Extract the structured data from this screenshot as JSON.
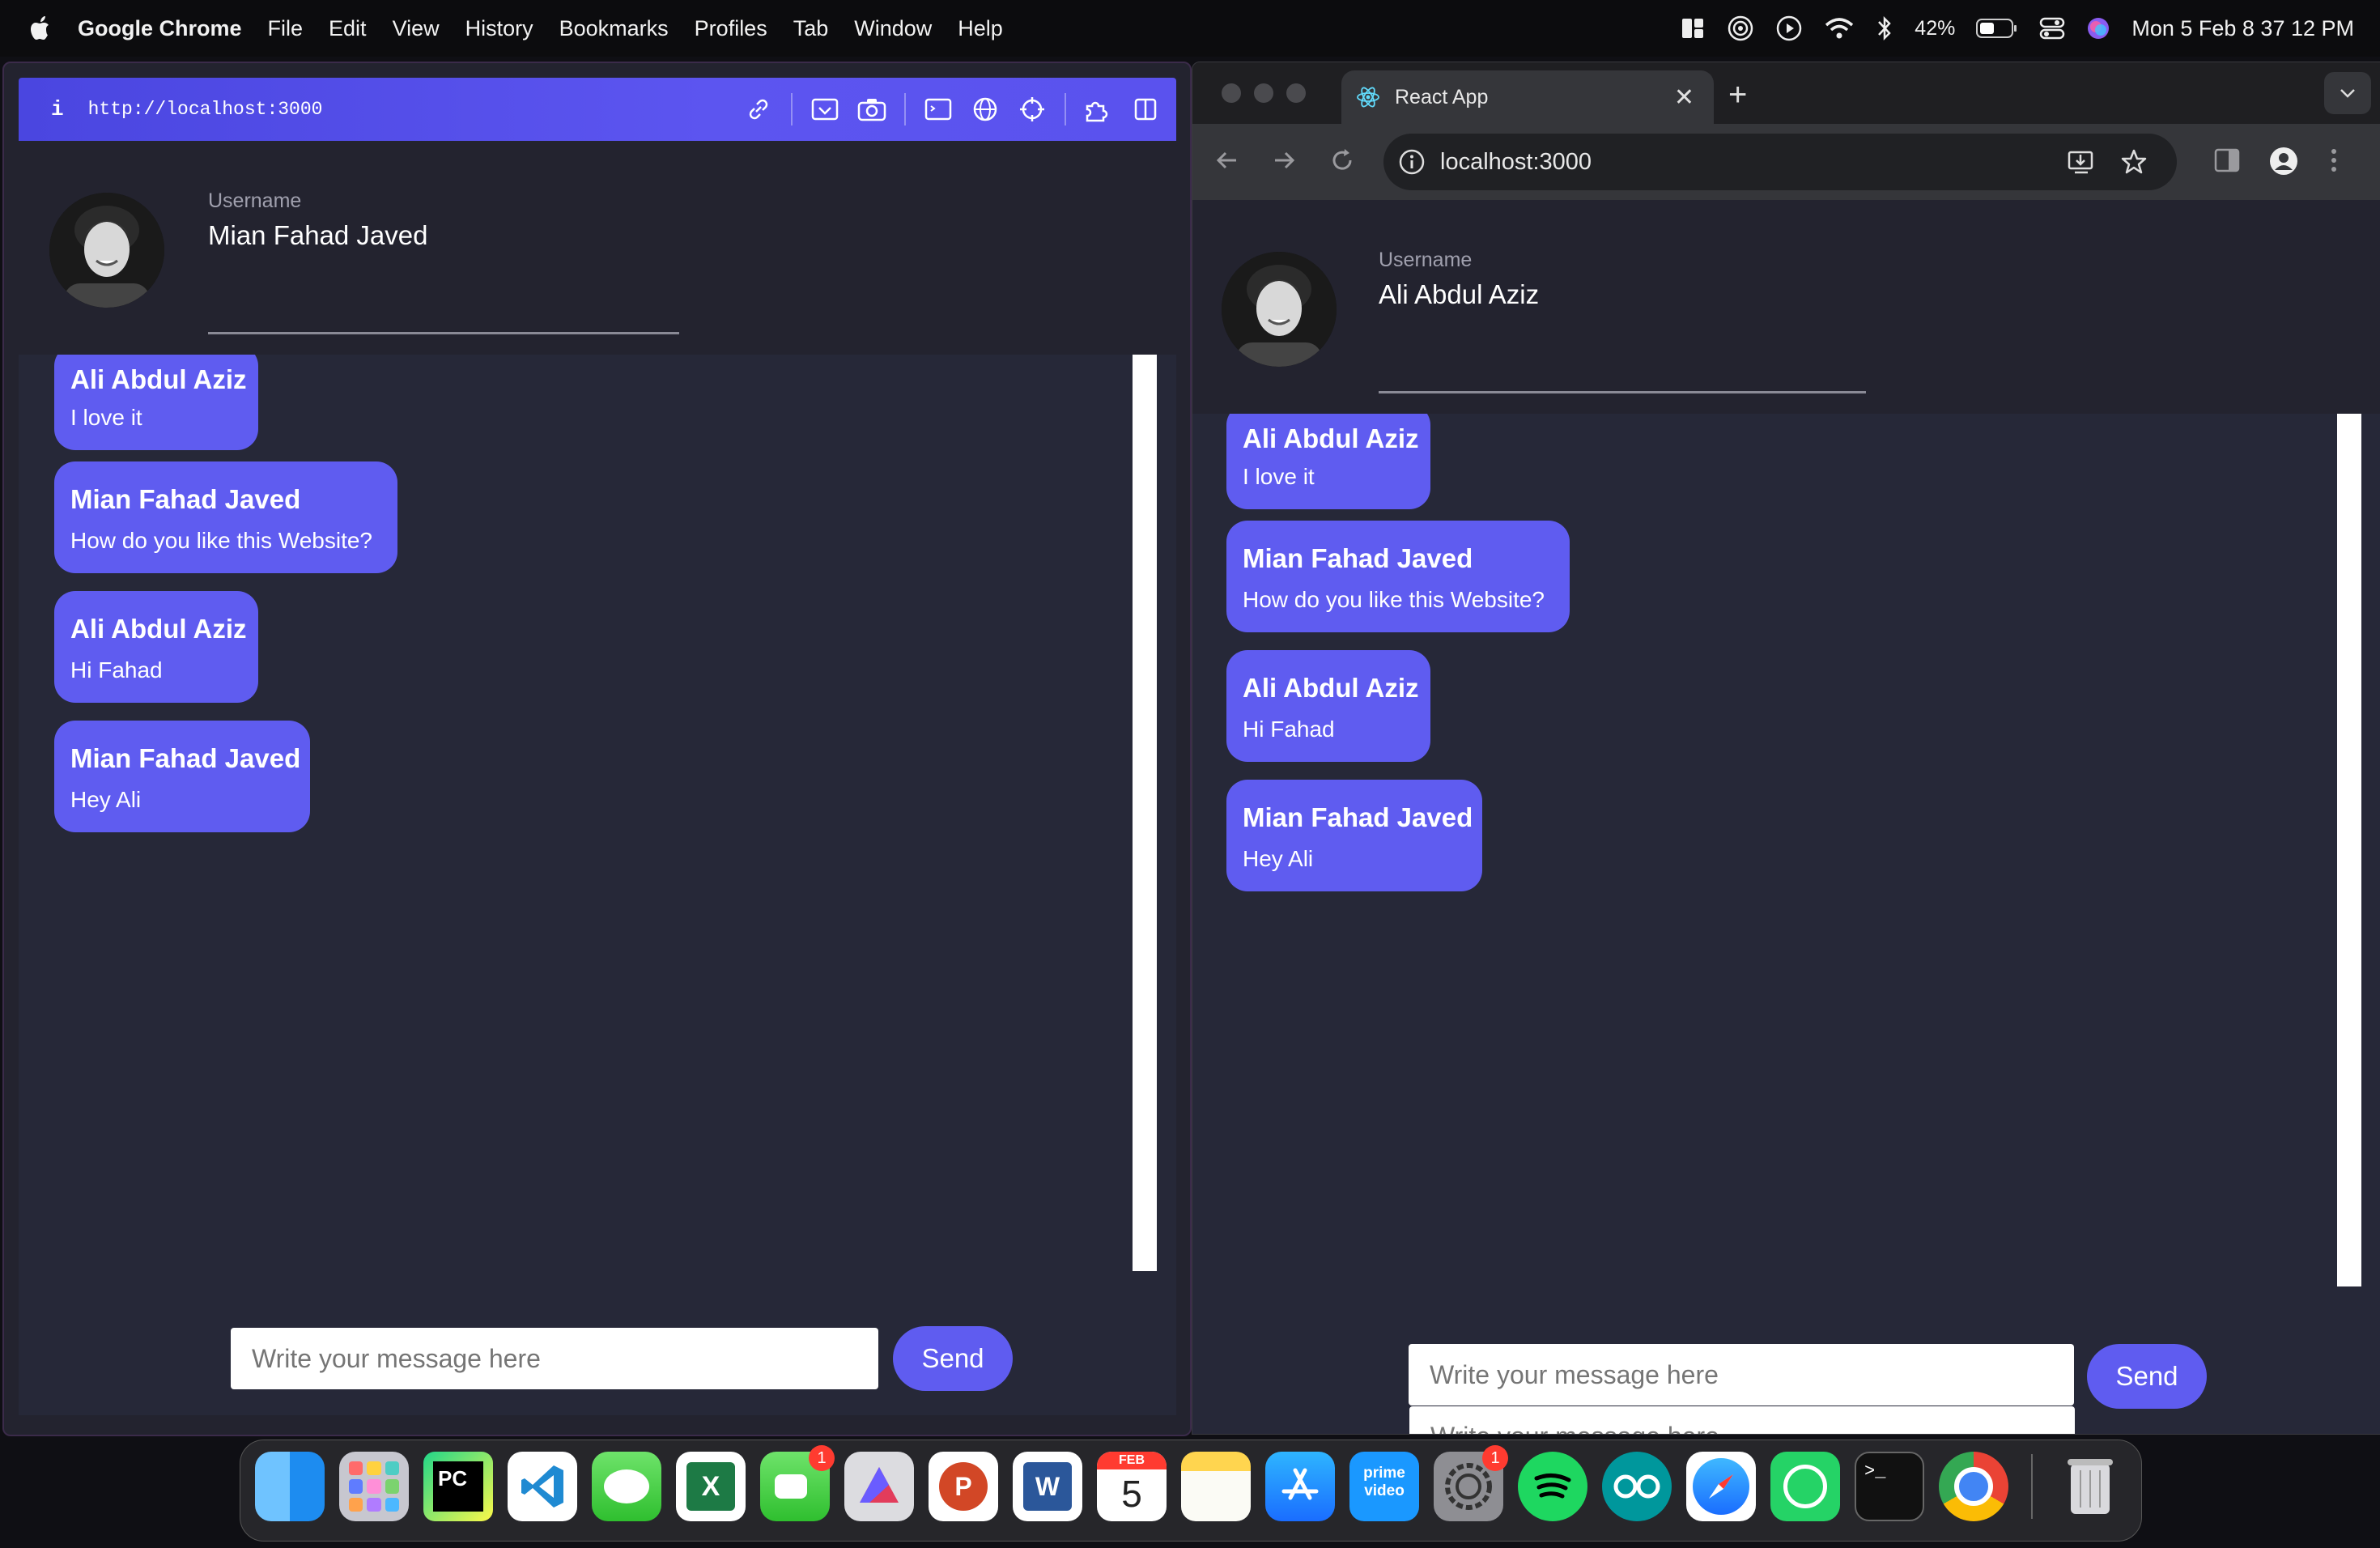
{
  "menubar": {
    "app_name": "Google Chrome",
    "items": [
      "File",
      "Edit",
      "View",
      "History",
      "Bookmarks",
      "Profiles",
      "Tab",
      "Window",
      "Help"
    ],
    "battery": "42%",
    "clock": "Mon 5 Feb  8 37 12 PM"
  },
  "left_window": {
    "info_label": "i",
    "url": "http://localhost:3000",
    "username_label": "Username",
    "username_value": "Mian Fahad Javed",
    "messages": [
      {
        "sender": "Ali Abdul Aziz",
        "text": "I love it"
      },
      {
        "sender": "Mian Fahad Javed",
        "text": "How do you like this Website?"
      },
      {
        "sender": "Ali Abdul Aziz",
        "text": "Hi Fahad"
      },
      {
        "sender": "Mian Fahad Javed",
        "text": "Hey Ali"
      }
    ],
    "input_placeholder": "Write your message here",
    "send_label": "Send"
  },
  "right_window": {
    "tab_title": "React App",
    "url": "localhost:3000",
    "username_label": "Username",
    "username_value": "Ali Abdul Aziz",
    "messages": [
      {
        "sender": "Ali Abdul Aziz",
        "text": "I love it"
      },
      {
        "sender": "Mian Fahad Javed",
        "text": "How do you like this Website?"
      },
      {
        "sender": "Ali Abdul Aziz",
        "text": "Hi Fahad"
      },
      {
        "sender": "Mian Fahad Javed",
        "text": "Hey Ali"
      }
    ],
    "input_placeholder": "Write your message here",
    "send_label": "Send"
  },
  "dock": {
    "apps": [
      "finder",
      "launchpad",
      "pycharm",
      "vscode",
      "messages",
      "excel",
      "facetime",
      "affinity",
      "powerpoint",
      "word",
      "calendar",
      "notes",
      "app-store",
      "prime-video",
      "system-settings",
      "spotify",
      "arduino",
      "safari",
      "whatsapp",
      "terminal",
      "chrome",
      "trash"
    ],
    "calendar_month": "FEB",
    "calendar_day": "5",
    "facetime_badge": "1",
    "settings_badge": "1",
    "prime_label_top": "prime",
    "prime_label_bottom": "video"
  }
}
